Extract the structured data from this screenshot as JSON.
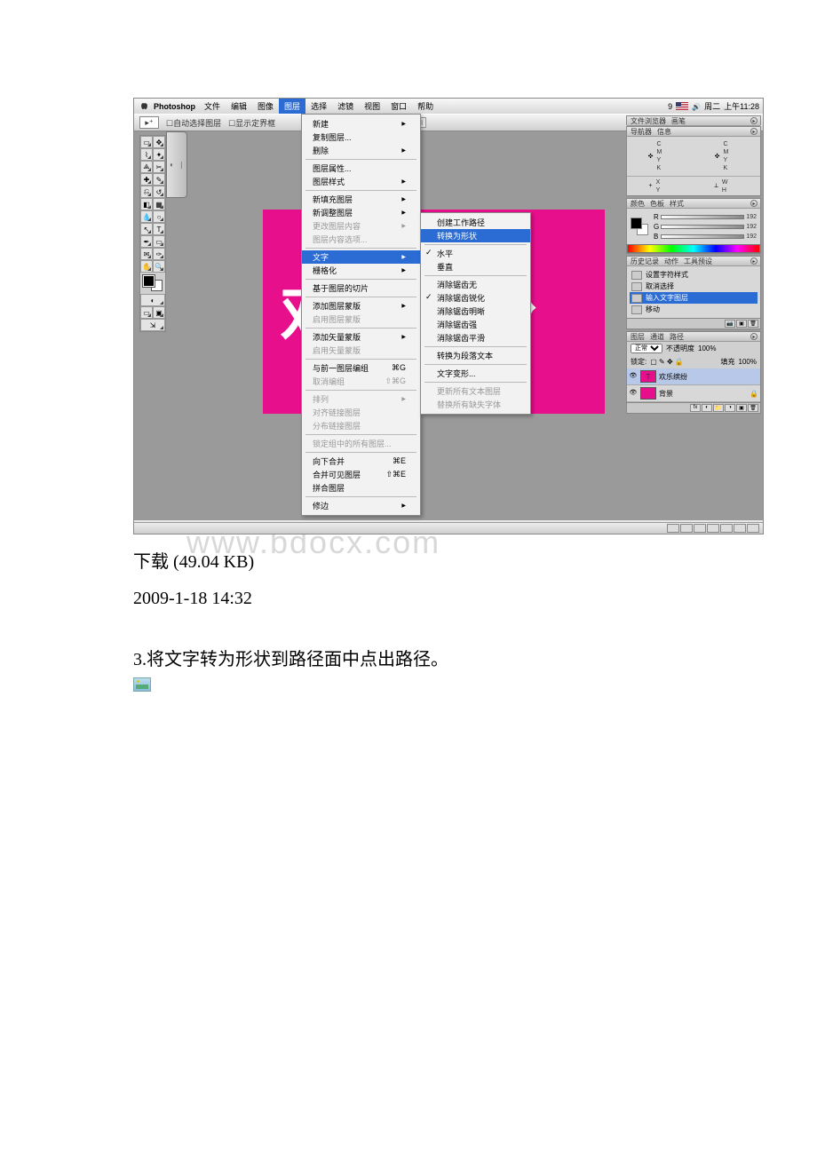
{
  "menubar": {
    "app": "Photoshop",
    "items": [
      "文件",
      "编辑",
      "图像",
      "图层",
      "选择",
      "滤镜",
      "视图",
      "窗口",
      "帮助"
    ],
    "active_index": 3,
    "right": {
      "num": "9",
      "day": "周二",
      "time": "上午11:28"
    }
  },
  "optbar": {
    "chk1": "自动选择图层",
    "chk2": "显示定界框"
  },
  "dropdown1": [
    {
      "t": "新建",
      "a": 1
    },
    {
      "t": "复制图层..."
    },
    {
      "t": "删除",
      "a": 1
    },
    {
      "sep": 1
    },
    {
      "t": "图层属性..."
    },
    {
      "t": "图层样式",
      "a": 1
    },
    {
      "sep": 1
    },
    {
      "t": "新填充图层",
      "a": 1
    },
    {
      "t": "新调整图层",
      "a": 1
    },
    {
      "t": "更改图层内容",
      "a": 1,
      "d": 1
    },
    {
      "t": "图层内容选项...",
      "d": 1
    },
    {
      "sep": 1
    },
    {
      "t": "文字",
      "a": 1,
      "hi": 1
    },
    {
      "t": "栅格化",
      "a": 1
    },
    {
      "sep": 1
    },
    {
      "t": "基于图层的切片"
    },
    {
      "sep": 1
    },
    {
      "t": "添加图层蒙版",
      "a": 1
    },
    {
      "t": "启用图层蒙版",
      "d": 1
    },
    {
      "sep": 1
    },
    {
      "t": "添加矢量蒙版",
      "a": 1
    },
    {
      "t": "启用矢量蒙版",
      "d": 1
    },
    {
      "sep": 1
    },
    {
      "t": "与前一图层编组",
      "s": "⌘G"
    },
    {
      "t": "取消编组",
      "s": "⇧⌘G",
      "d": 1
    },
    {
      "sep": 1
    },
    {
      "t": "排列",
      "a": 1,
      "d": 1
    },
    {
      "t": "对齐链接图层",
      "d": 1
    },
    {
      "t": "分布链接图层",
      "d": 1
    },
    {
      "sep": 1
    },
    {
      "t": "锁定组中的所有图层...",
      "d": 1
    },
    {
      "sep": 1
    },
    {
      "t": "向下合并",
      "s": "⌘E"
    },
    {
      "t": "合并可见图层",
      "s": "⇧⌘E"
    },
    {
      "t": "拼合图层"
    },
    {
      "sep": 1
    },
    {
      "t": "修边",
      "a": 1
    }
  ],
  "dropdown2": [
    {
      "t": "创建工作路径"
    },
    {
      "t": "转换为形状",
      "hi": 1
    },
    {
      "sep": 1
    },
    {
      "t": "水平",
      "c": 1
    },
    {
      "t": "垂直"
    },
    {
      "sep": 1
    },
    {
      "t": "消除锯齿无"
    },
    {
      "t": "消除锯齿锐化",
      "c": 1
    },
    {
      "t": "消除锯齿明晰"
    },
    {
      "t": "消除锯齿强"
    },
    {
      "t": "消除锯齿平滑"
    },
    {
      "sep": 1
    },
    {
      "t": "转换为段落文本"
    },
    {
      "sep": 1
    },
    {
      "t": "文字变形..."
    },
    {
      "sep": 1
    },
    {
      "t": "更新所有文本图层",
      "d": 1
    },
    {
      "t": "替换所有缺失字体",
      "d": 1
    }
  ],
  "canvas_text": "欢乐缤纷",
  "panels": {
    "filebrowser": {
      "tabs": [
        "文件浏览器",
        "画笔"
      ]
    },
    "nav": {
      "tabs": [
        "导航器",
        "信息"
      ],
      "labels": {
        "c": "C",
        "m": "M",
        "y": "Y",
        "k": "K",
        "x": "X",
        "y2": "Y",
        "w": "W",
        "h": "H"
      }
    },
    "color": {
      "tabs": [
        "颜色",
        "色板",
        "样式"
      ],
      "val": "192"
    },
    "hist": {
      "tabs": [
        "历史记录",
        "动作",
        "工具预设"
      ],
      "rows": [
        {
          "t": "设置字符样式"
        },
        {
          "t": "取消选择"
        },
        {
          "t": "输入文字图层",
          "hi": 1
        },
        {
          "t": "移动"
        }
      ]
    },
    "layers": {
      "tabs": [
        "图层",
        "通道",
        "路径"
      ],
      "mode": "正常",
      "opacity": "不透明度",
      "opval": "100%",
      "fill": "填充",
      "fillval": "100%",
      "lock": "锁定:",
      "rows": [
        {
          "name": "欢乐缤纷",
          "sel": 1,
          "thumb": "#e80f8c",
          "t": "T"
        },
        {
          "name": "背景",
          "thumb": "#e80f8c",
          "lock": 1
        }
      ]
    }
  },
  "caption": {
    "download": "下载",
    "size": "(49.04 KB)",
    "date": "2009-1-18 14:32"
  },
  "step": "3.将文字转为形状到路径面中点出路径。",
  "watermark": "www.bdocx.com"
}
